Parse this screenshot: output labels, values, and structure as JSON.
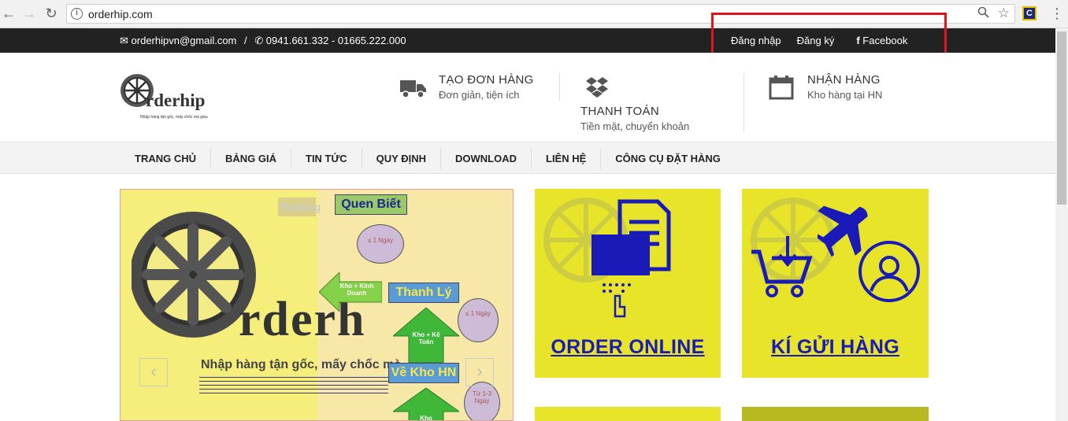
{
  "browser": {
    "url": "orderhip.com",
    "ext_label": "C"
  },
  "topbar": {
    "email": "orderhipvn@gmail.com",
    "separator": "/",
    "phone": "0941.661.332 - 01665.222.000",
    "login": "Đăng nhập",
    "register": "Đăng ký",
    "facebook": "Facebook"
  },
  "logo": {
    "name": "rderhip",
    "tagline": "Nhập hàng tận gốc, mấy chốc mà giàu"
  },
  "features": [
    {
      "title": "TẠO ĐƠN HÀNG",
      "sub": "Đơn giản, tiện ích",
      "icon": "truck-icon"
    },
    {
      "title": "THANH TOÁN",
      "sub": "Tiền mặt, chuyển khoản",
      "icon": "dropbox-icon"
    },
    {
      "title": "NHẬN HÀNG",
      "sub": "Kho hàng tại HN",
      "icon": "calendar-icon"
    }
  ],
  "nav": [
    "TRANG CHỦ",
    "BẢNG GIÁ",
    "TIN TỨC",
    "QUY ĐỊNH",
    "DOWNLOAD",
    "LIÊN HỆ",
    "CÔNG CỤ ĐẶT HÀNG"
  ],
  "slider": {
    "brand": "rderh",
    "tagline": "Nhập hàng tận gốc, mấy chốc mà",
    "label_quen_biet": "Quen Biết",
    "label_thuong": "Thường",
    "label_thanh_ly": "Thanh Lý",
    "label_ve_kho": "Về Kho HN",
    "bubble1": "≤ 1 Ngày",
    "bubble2": "≤ 1 Ngày",
    "bubble3": "Từ 1-3 Ngày",
    "arrow1": "Kho + Kinh Doanh",
    "arrow2": "Kho + Kế Toán",
    "arrow3": "Kho",
    "prev": "‹",
    "next": "›"
  },
  "tiles": [
    {
      "title": "ORDER ONLINE"
    },
    {
      "title": "KÍ GỬI HÀNG"
    }
  ],
  "colors": {
    "topbar_bg": "#222222",
    "tile_yellow": "#e7e42a",
    "tile_text": "#1a1ab8",
    "highlight_red": "#e0141b"
  }
}
